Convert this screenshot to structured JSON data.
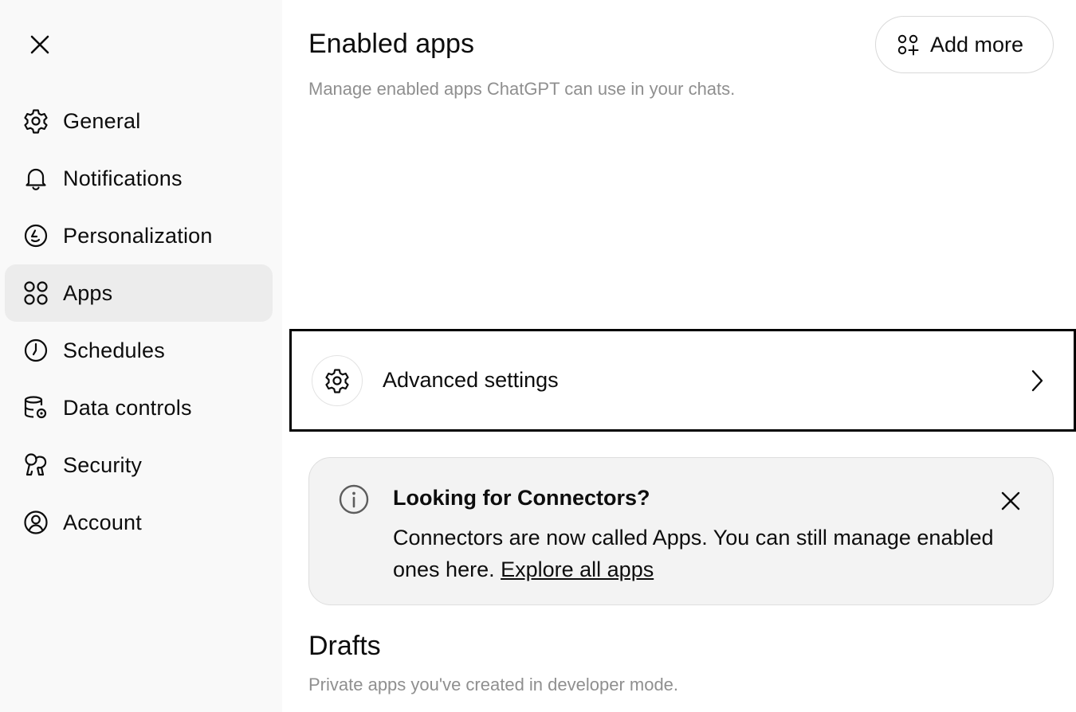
{
  "sidebar": {
    "items": [
      {
        "id": "general",
        "label": "General",
        "icon": "gear-icon",
        "active": false
      },
      {
        "id": "notifications",
        "label": "Notifications",
        "icon": "bell-icon",
        "active": false
      },
      {
        "id": "personalization",
        "label": "Personalization",
        "icon": "personalization-icon",
        "active": false
      },
      {
        "id": "apps",
        "label": "Apps",
        "icon": "apps-grid-icon",
        "active": true
      },
      {
        "id": "schedules",
        "label": "Schedules",
        "icon": "clock-icon",
        "active": false
      },
      {
        "id": "data-controls",
        "label": "Data controls",
        "icon": "database-gear-icon",
        "active": false
      },
      {
        "id": "security",
        "label": "Security",
        "icon": "key-shield-icon",
        "active": false
      },
      {
        "id": "account",
        "label": "Account",
        "icon": "user-circle-icon",
        "active": false
      }
    ]
  },
  "main": {
    "title": "Enabled apps",
    "subtitle": "Manage enabled apps ChatGPT can use in your chats.",
    "add_more_label": "Add more",
    "advanced_settings_label": "Advanced settings",
    "info_card": {
      "title": "Looking for Connectors?",
      "body": "Connectors are now called Apps. You can still manage enabled ones here. ",
      "link_label": "Explore all apps"
    },
    "drafts": {
      "title": "Drafts",
      "subtitle": "Private apps you've created in developer mode."
    }
  },
  "colors": {
    "sidebar_bg": "#f9f9f9",
    "active_item_bg": "#ececec",
    "card_bg": "#f3f3f3",
    "muted_text": "#8f8f8f",
    "focus_outline": "#000000"
  }
}
